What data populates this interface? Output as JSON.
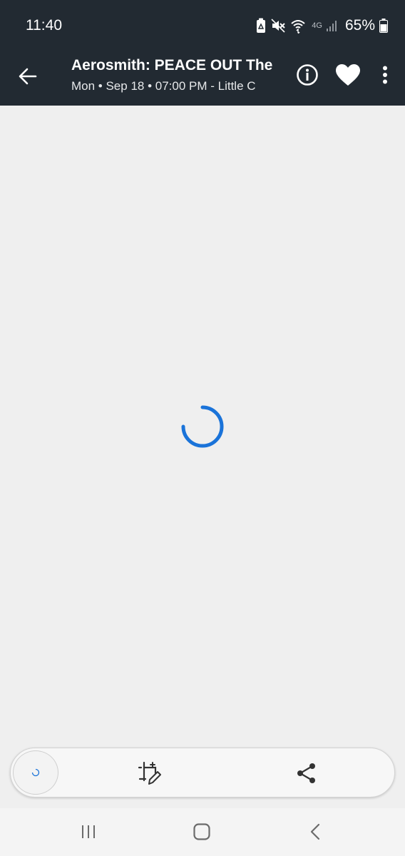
{
  "status_bar": {
    "time": "11:40",
    "network": "4G",
    "battery": "65%",
    "icons": [
      "recycle-icon",
      "mute-icon",
      "wifi-icon",
      "signal-icon",
      "battery-icon"
    ]
  },
  "header": {
    "title": "Aerosmith: PEACE OUT The",
    "subtitle": "Mon • Sep 18 • 07:00 PM - Little C",
    "icons": [
      "back-arrow-icon",
      "info-icon",
      "heart-icon",
      "more-vert-icon"
    ]
  },
  "content": {
    "state": "loading",
    "spinner_color": "#1a73d9"
  },
  "toolbar": {
    "icons": [
      "loading-icon",
      "smart-select-icon",
      "share-icon"
    ]
  },
  "nav": {
    "icons": [
      "recents-icon",
      "home-icon",
      "back-icon"
    ]
  },
  "colors": {
    "header_bg": "#222a32",
    "page_bg": "#efefef",
    "accent": "#1a73d9"
  }
}
